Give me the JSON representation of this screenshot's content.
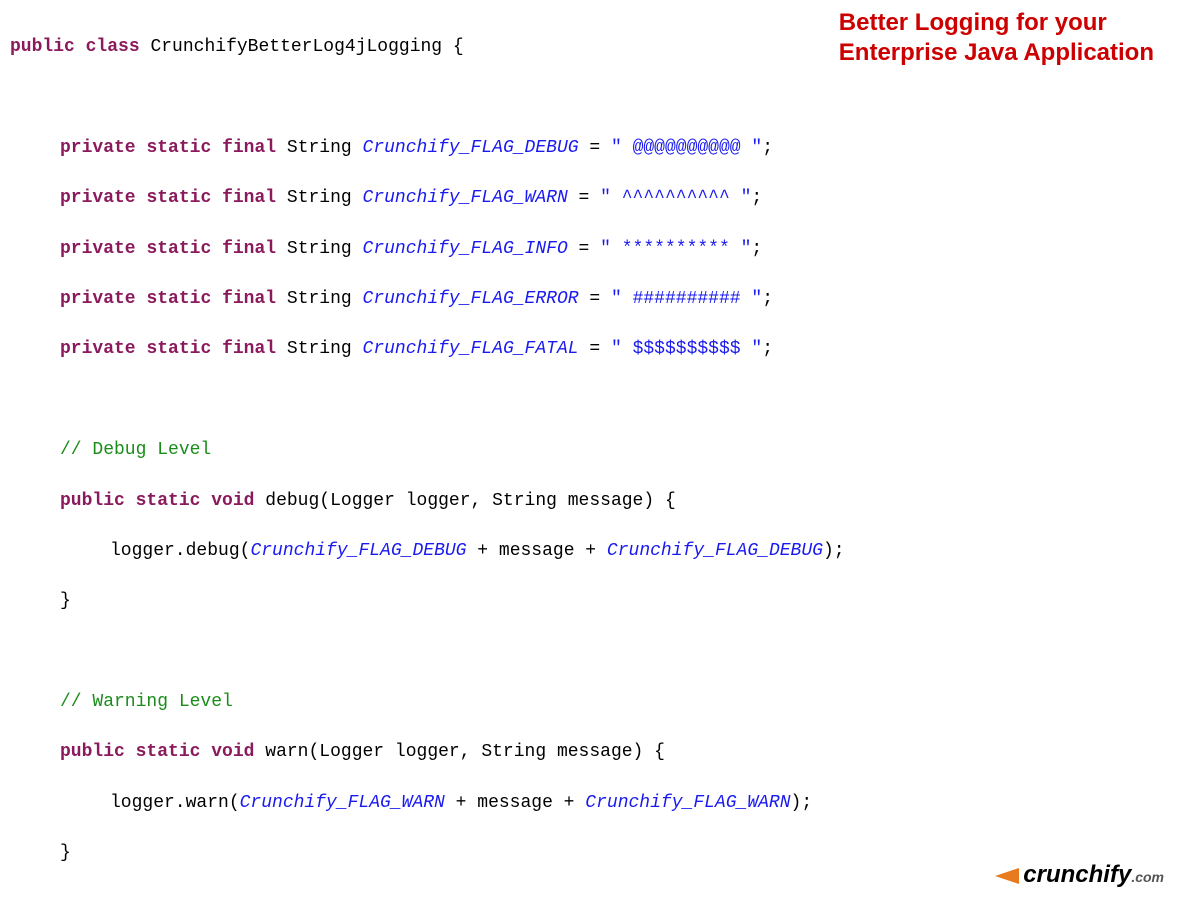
{
  "title": {
    "line1": "Better Logging for your",
    "line2": "Enterprise Java Application"
  },
  "kw": {
    "public": "public",
    "class": "class",
    "private": "private",
    "static": "static",
    "final": "final",
    "void": "void"
  },
  "class_name": "CrunchifyBetterLog4jLogging",
  "type_string": "String",
  "fields": {
    "debug": {
      "name": "Crunchify_FLAG_DEBUG",
      "value": "\" @@@@@@@@@@ \""
    },
    "warn": {
      "name": "Crunchify_FLAG_WARN",
      "value": "\" ^^^^^^^^^^ \""
    },
    "info": {
      "name": "Crunchify_FLAG_INFO",
      "value": "\" ********** \""
    },
    "error": {
      "name": "Crunchify_FLAG_ERROR",
      "value": "\" ########## \""
    },
    "fatal": {
      "name": "Crunchify_FLAG_FATAL",
      "value": "\" $$$$$$$$$$ \""
    }
  },
  "comments": {
    "debug": "// Debug Level",
    "warn": "// Warning Level"
  },
  "methods": {
    "debug": {
      "sig_name": "debug",
      "params": "(Logger logger, String message) {",
      "body_prefix": "logger.debug(",
      "plus": " + message + ",
      "close": ");"
    },
    "warn": {
      "sig_name": "warn",
      "params": "(Logger logger, String message) {",
      "body_prefix": "logger.warn(",
      "plus": " + message + ",
      "close": ");"
    }
  },
  "punct": {
    "open_brace": " {",
    "close_brace": "}",
    "eq": " = ",
    "semi": ";"
  },
  "watermark": {
    "brand": "crunchify",
    "tld": ".com"
  }
}
